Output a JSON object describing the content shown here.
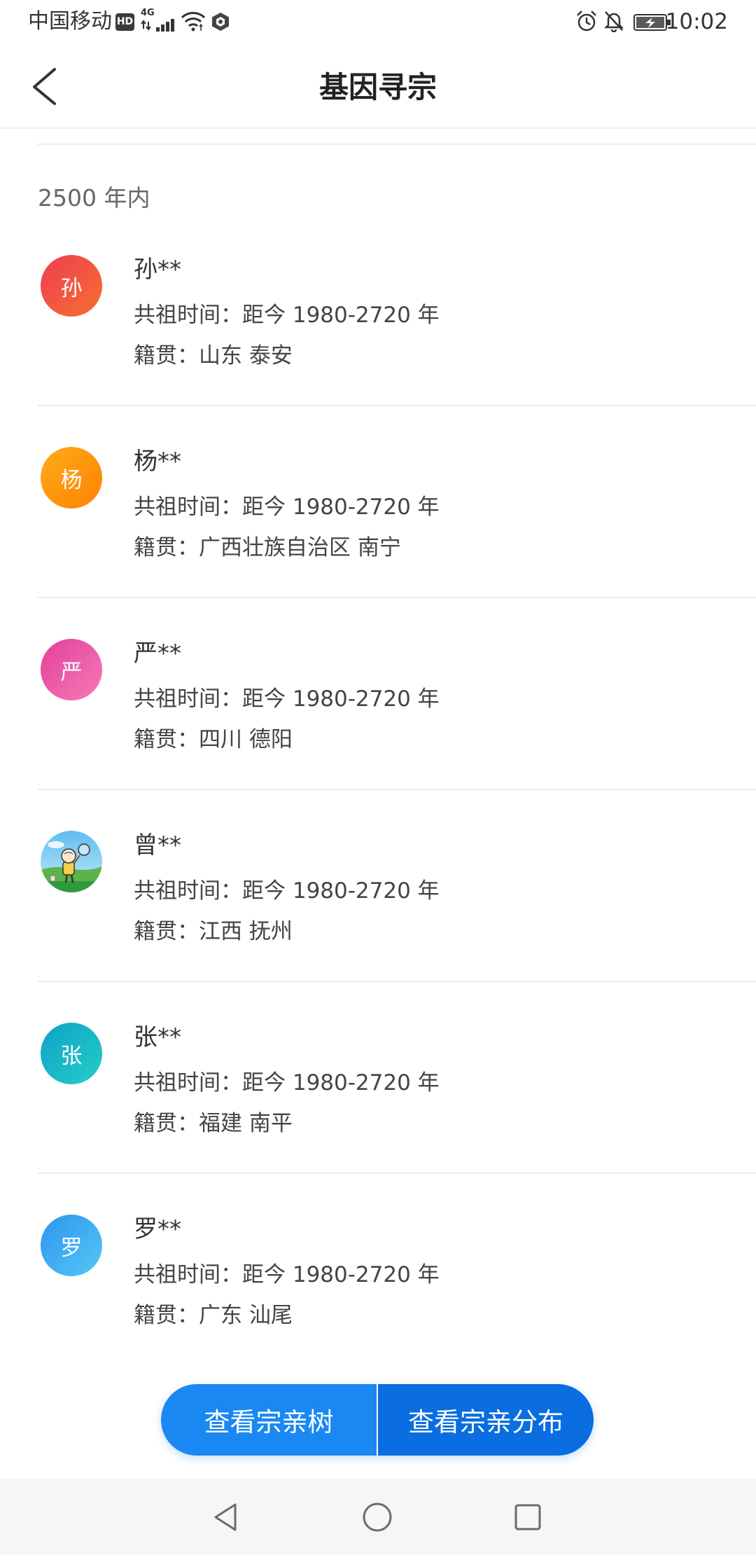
{
  "status_bar": {
    "carrier": "中国移动",
    "hd_label": "HD",
    "network_label": "4G",
    "time": "10:02",
    "icons": {
      "left": [
        "hd-icon",
        "signal-icon",
        "wifi-icon",
        "shield-icon"
      ],
      "right": [
        "alarm-icon",
        "bell-off-icon",
        "battery-icon"
      ]
    }
  },
  "header": {
    "title": "基因寻宗",
    "back_icon": "chevron-left-icon"
  },
  "section": {
    "label": "2500 年内"
  },
  "relatives": [
    {
      "avatar_char": "孙",
      "avatar_colors": [
        "#ee3d50",
        "#f5702f"
      ],
      "name": "孙**",
      "ancestor_label": "共祖时间：",
      "ancestor_value": "距今 1980-2720 年",
      "origin_label": "籍贯：",
      "origin_value": "山东 泰安"
    },
    {
      "avatar_char": "杨",
      "avatar_colors": [
        "#ffab1a",
        "#ff8200"
      ],
      "name": "杨**",
      "ancestor_label": "共祖时间：",
      "ancestor_value": "距今 1980-2720 年",
      "origin_label": "籍贯：",
      "origin_value": "广西壮族自治区 南宁"
    },
    {
      "avatar_char": "严",
      "avatar_colors": [
        "#e2409b",
        "#f77ab6"
      ],
      "name": "严**",
      "ancestor_label": "共祖时间：",
      "ancestor_value": "距今 1980-2720 年",
      "origin_label": "籍贯：",
      "origin_value": "四川 德阳"
    },
    {
      "avatar_icon": "cartoon-avatar-icon",
      "name": "曾**",
      "ancestor_label": "共祖时间：",
      "ancestor_value": "距今 1980-2720 年",
      "origin_label": "籍贯：",
      "origin_value": "江西 抚州"
    },
    {
      "avatar_char": "张",
      "avatar_colors": [
        "#0ea0c8",
        "#25cfc6"
      ],
      "name": "张**",
      "ancestor_label": "共祖时间：",
      "ancestor_value": "距今 1980-2720 年",
      "origin_label": "籍贯：",
      "origin_value": "福建 南平"
    },
    {
      "avatar_char": "罗",
      "avatar_colors": [
        "#2a96ee",
        "#58c6f6"
      ],
      "name": "罗**",
      "ancestor_label": "共祖时间：",
      "ancestor_value": "距今 1980-2720 年",
      "origin_label": "籍贯：",
      "origin_value": "广东 汕尾"
    }
  ],
  "actions": {
    "tree_label": "查看宗亲树",
    "distribution_label": "查看宗亲分布"
  },
  "nav_bar": {
    "icons": [
      "back-triangle-icon",
      "home-circle-icon",
      "recents-square-icon"
    ]
  },
  "colors": {
    "title_text": "#222222",
    "name_text": "#333333",
    "detail_text": "#444444",
    "section_text": "#666666",
    "divider": "#ececec",
    "button_tree": "#1a88f2",
    "button_distribution": "#0a6de0",
    "nav_background": "#f6f6f6",
    "nav_icon": "#6b6b6b"
  }
}
